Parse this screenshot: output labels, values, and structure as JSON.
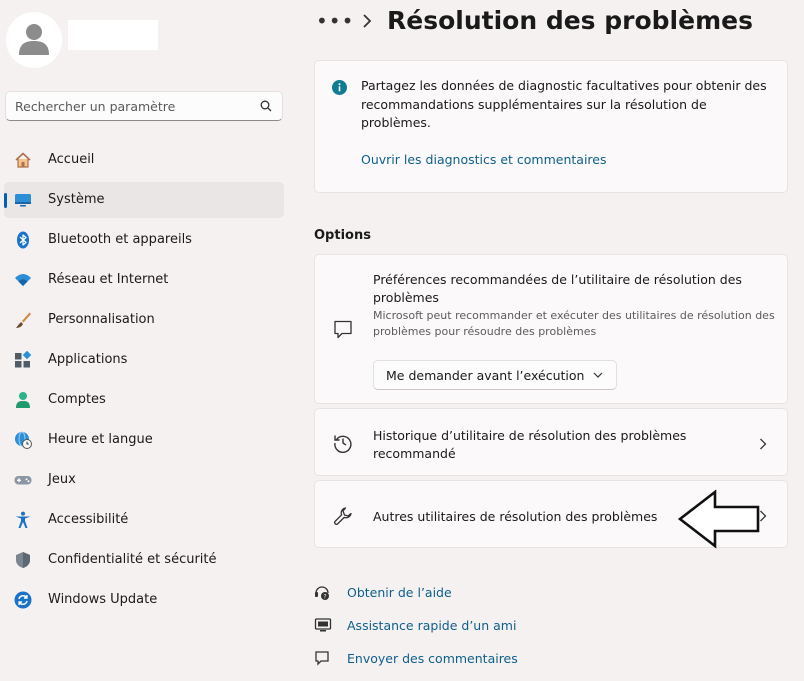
{
  "user": {
    "avatar_icon": "person-icon"
  },
  "search": {
    "placeholder": "Rechercher un paramètre",
    "icon": "search-icon"
  },
  "sidebar": {
    "items": [
      {
        "label": "Accueil",
        "icon": "home-icon",
        "active": false
      },
      {
        "label": "Système",
        "icon": "display-icon",
        "active": true
      },
      {
        "label": "Bluetooth et appareils",
        "icon": "bluetooth-icon",
        "active": false
      },
      {
        "label": "Réseau et Internet",
        "icon": "wifi-icon",
        "active": false
      },
      {
        "label": "Personnalisation",
        "icon": "brush-icon",
        "active": false
      },
      {
        "label": "Applications",
        "icon": "apps-icon",
        "active": false
      },
      {
        "label": "Comptes",
        "icon": "account-icon",
        "active": false
      },
      {
        "label": "Heure et langue",
        "icon": "globe-clock-icon",
        "active": false
      },
      {
        "label": "Jeux",
        "icon": "gamepad-icon",
        "active": false
      },
      {
        "label": "Accessibilité",
        "icon": "accessibility-icon",
        "active": false
      },
      {
        "label": "Confidentialité et sécurité",
        "icon": "shield-icon",
        "active": false
      },
      {
        "label": "Windows Update",
        "icon": "update-icon",
        "active": false
      }
    ]
  },
  "header": {
    "breadcrumb_dots": "•••",
    "title": "Résolution des problèmes"
  },
  "info_card": {
    "text": "Partagez les données de diagnostic facultatives pour obtenir des recommandations supplémentaires sur la résolution de problèmes.",
    "link": "Ouvrir les diagnostics et commentaires"
  },
  "options": {
    "section_title": "Options",
    "preferences": {
      "title": "Préférences recommandées de l’utilitaire de résolution des problèmes",
      "description": "Microsoft peut recommander et exécuter des utilitaires de résolution des problèmes pour résoudre des problèmes",
      "dropdown_value": "Me demander avant l’exécution"
    },
    "history": {
      "title": "Historique d’utilitaire de résolution des problèmes recommandé"
    },
    "other": {
      "title": "Autres utilitaires de résolution des problèmes"
    }
  },
  "help_links": [
    {
      "label": "Obtenir de l’aide",
      "icon": "help-icon"
    },
    {
      "label": "Assistance rapide d’un ami",
      "icon": "remote-assist-icon"
    },
    {
      "label": "Envoyer des commentaires",
      "icon": "feedback-icon"
    }
  ],
  "colors": {
    "accent": "#005fb8",
    "link": "#0d5f8c",
    "info_icon": "#0e7d91"
  }
}
